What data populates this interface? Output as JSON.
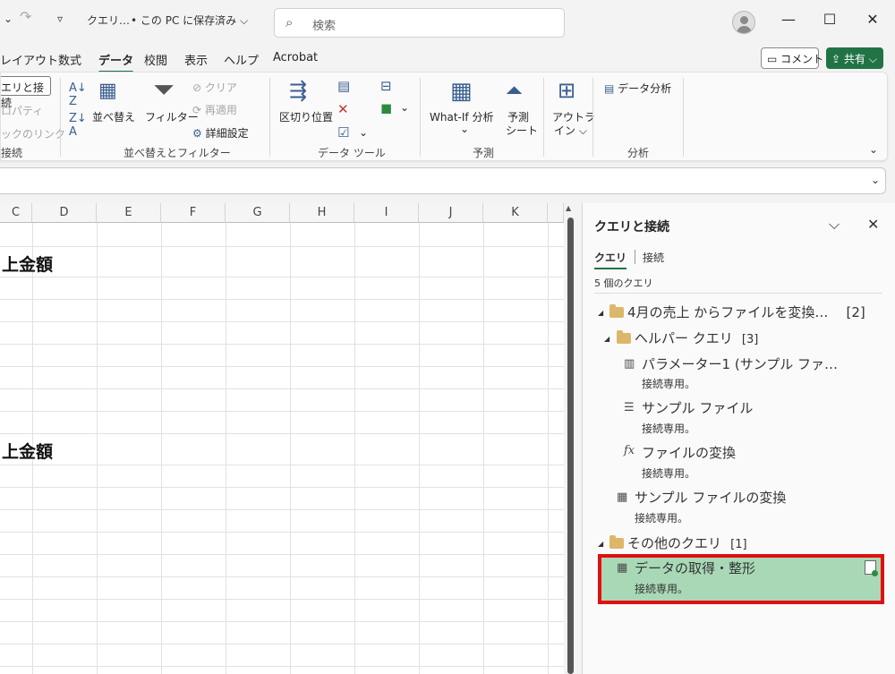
{
  "titlebar": {
    "undo_chevron": "⌄",
    "redo_icon": "↷",
    "qat_icon": "▿",
    "doc_name": "クエリ…",
    "save_state": "• この PC に保存済み ⌵",
    "search_placeholder": "検索",
    "minimize": "—",
    "maximize": "☐",
    "close": "✕"
  },
  "tabs": [
    "レイアウト",
    "数式",
    "データ",
    "校閲",
    "表示",
    "ヘルプ",
    "Acrobat"
  ],
  "active_tab": "データ",
  "comment_label": "コメント",
  "share_label": "共有 ⌵",
  "ribbon": {
    "conn_button": "エリと接続",
    "properties": "ロパティ",
    "links": "ックのリンク",
    "group_conn": "接続",
    "sort_label": "並べ替え",
    "filter_label": "フィルター",
    "clear_label": "クリア",
    "reapply_label": "再適用",
    "advanced_label": "詳細設定",
    "group_sort": "並べ替えとフィルター",
    "split_label": "区切り位置",
    "group_tools": "データ ツール",
    "whatif_label": "What-If 分析",
    "forecast_label1": "予測",
    "forecast_label2": "シート",
    "group_forecast": "予測",
    "outline_label1": "アウトラ",
    "outline_label2": "イン ⌵",
    "analysis_label": "データ分析",
    "group_analysis": "分析",
    "down_caret": "⌄"
  },
  "grid": {
    "columns": [
      "C",
      "D",
      "E",
      "F",
      "G",
      "H",
      "I",
      "J",
      "K"
    ],
    "cell_title_1": "上金額",
    "cell_title_2": "上金額"
  },
  "pane": {
    "title": "クエリと接続",
    "tab_queries": "クエリ",
    "tab_connections": "接続",
    "count": "5 個のクエリ",
    "group1_name": "4月の売上 からファイルを変換…",
    "group1_count": "[2]",
    "group2_name": "ヘルパー クエリ",
    "group2_count": "[3]",
    "q_param": "パラメーター1 (サンプル ファ…",
    "q_param_sub": "接続専用。",
    "q_sample": "サンプル ファイル",
    "q_sample_sub": "接続専用。",
    "q_transform": "ファイルの変換",
    "q_transform_sub": "接続専用。",
    "q_sample_transform": "サンプル ファイルの変換",
    "q_sample_transform_sub": "接続専用。",
    "group3_name": "その他のクエリ",
    "group3_count": "[1]",
    "q_selected": "データの取得・整形",
    "q_selected_sub": "接続専用。"
  },
  "colors": {
    "accent_green": "#217346",
    "selection_fill": "#a9d8b6",
    "highlight_red": "#e01010"
  }
}
